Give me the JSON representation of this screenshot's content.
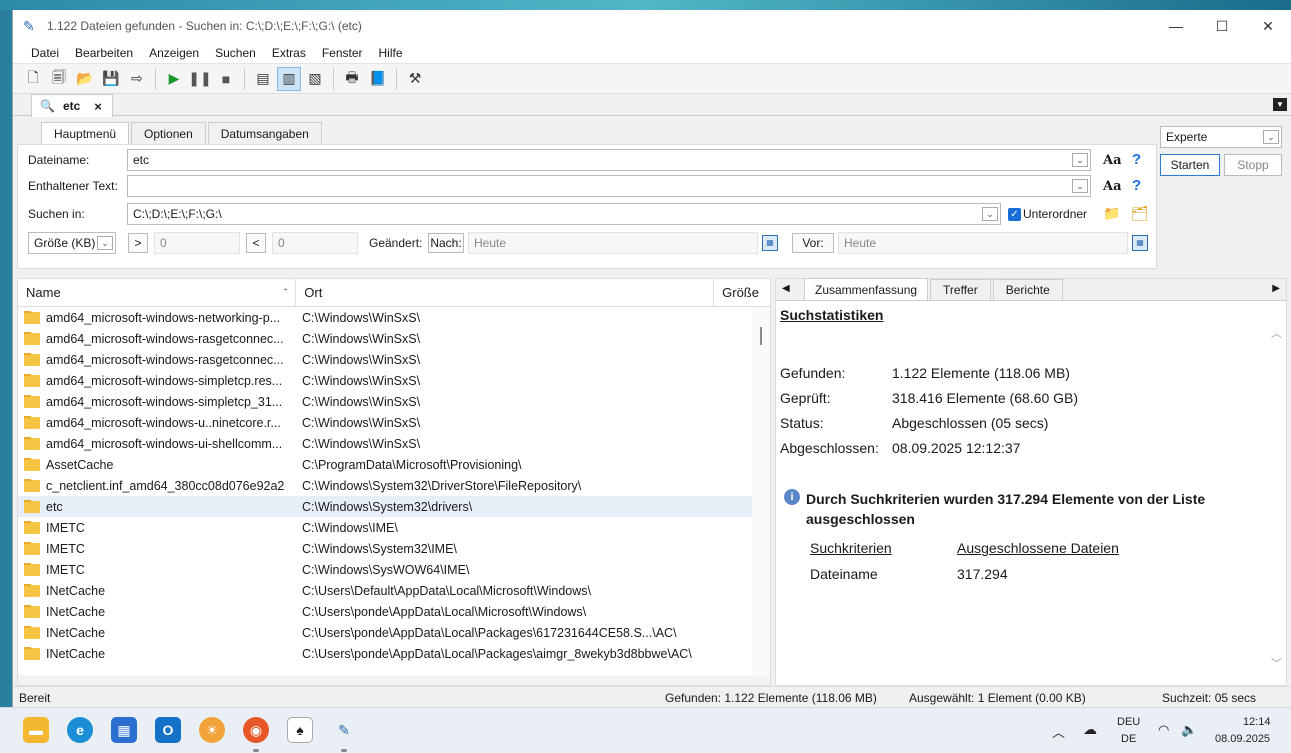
{
  "window": {
    "title": "1.122 Dateien gefunden - Suchen in: C:\\;D:\\;E:\\;F:\\;G:\\ (etc)",
    "minimize": "—",
    "maximize": "☐",
    "close": "✕"
  },
  "menu": [
    "Datei",
    "Bearbeiten",
    "Anzeigen",
    "Suchen",
    "Extras",
    "Fenster",
    "Hilfe"
  ],
  "doctab": {
    "label": "etc",
    "close": "×"
  },
  "subtabs": [
    "Hauptmenü",
    "Optionen",
    "Datumsangaben"
  ],
  "form": {
    "filename_label": "Dateiname:",
    "filename_value": "etc",
    "content_label": "Enthaltener Text:",
    "content_value": "",
    "searchin_label": "Suchen in:",
    "searchin_value": "C:\\;D:\\;E:\\;F:\\;G:\\",
    "subfolders_label": "Unterordner",
    "size_select": "Größe (KB)",
    "gt": ">",
    "gt_value": "0",
    "lt": "<",
    "lt_value": "0",
    "changed_label": "Geändert:",
    "after_btn": "Nach:",
    "after_value": "Heute",
    "before_btn": "Vor:",
    "before_value": "Heute",
    "aa": "Aa",
    "help": "?"
  },
  "mode": {
    "selected": "Experte",
    "start": "Starten",
    "stop": "Stopp"
  },
  "results": {
    "columns": [
      "Name",
      "Ort",
      "Größe"
    ],
    "rows": [
      {
        "name": "amd64_microsoft-windows-networking-p...",
        "path": "C:\\Windows\\WinSxS\\"
      },
      {
        "name": "amd64_microsoft-windows-rasgetconnec...",
        "path": "C:\\Windows\\WinSxS\\"
      },
      {
        "name": "amd64_microsoft-windows-rasgetconnec...",
        "path": "C:\\Windows\\WinSxS\\"
      },
      {
        "name": "amd64_microsoft-windows-simpletcp.res...",
        "path": "C:\\Windows\\WinSxS\\"
      },
      {
        "name": "amd64_microsoft-windows-simpletcp_31...",
        "path": "C:\\Windows\\WinSxS\\"
      },
      {
        "name": "amd64_microsoft-windows-u..ninetcore.r...",
        "path": "C:\\Windows\\WinSxS\\"
      },
      {
        "name": "amd64_microsoft-windows-ui-shellcomm...",
        "path": "C:\\Windows\\WinSxS\\"
      },
      {
        "name": "AssetCache",
        "path": "C:\\ProgramData\\Microsoft\\Provisioning\\"
      },
      {
        "name": "c_netclient.inf_amd64_380cc08d076e92a2",
        "path": "C:\\Windows\\System32\\DriverStore\\FileRepository\\"
      },
      {
        "name": "etc",
        "path": "C:\\Windows\\System32\\drivers\\"
      },
      {
        "name": "IMETC",
        "path": "C:\\Windows\\IME\\"
      },
      {
        "name": "IMETC",
        "path": "C:\\Windows\\System32\\IME\\"
      },
      {
        "name": "IMETC",
        "path": "C:\\Windows\\SysWOW64\\IME\\"
      },
      {
        "name": "INetCache",
        "path": "C:\\Users\\Default\\AppData\\Local\\Microsoft\\Windows\\"
      },
      {
        "name": "INetCache",
        "path": "C:\\Users\\ponde\\AppData\\Local\\Microsoft\\Windows\\"
      },
      {
        "name": "INetCache",
        "path": "C:\\Users\\ponde\\AppData\\Local\\Packages\\617231644CE58.S...\\AC\\"
      },
      {
        "name": "INetCache",
        "path": "C:\\Users\\ponde\\AppData\\Local\\Packages\\aimgr_8wekyb3d8bbwe\\AC\\"
      }
    ]
  },
  "summary": {
    "tabs": [
      "Zusammenfassung",
      "Treffer",
      "Berichte"
    ],
    "heading": "Suchstatistiken",
    "stats": [
      {
        "label": "Gefunden:",
        "value": "1.122 Elemente (118.06 MB)"
      },
      {
        "label": "Geprüft:",
        "value": "318.416 Elemente (68.60 GB)"
      },
      {
        "label": "Status:",
        "value": "Abgeschlossen (05 secs)"
      },
      {
        "label": "Abgeschlossen:",
        "value": "08.09.2025 12:12:37"
      }
    ],
    "message": "Durch Suchkriterien wurden 317.294 Elemente von der Liste ausgeschlossen",
    "crit_header": "Suchkriterien",
    "excl_header": "Ausgeschlossene Dateien",
    "crit_name": "Dateiname",
    "crit_count": "317.294"
  },
  "status": {
    "ready": "Bereit",
    "found": "Gefunden: 1.122 Elemente (118.06 MB)",
    "selected": "Ausgewählt: 1 Element (0.00 KB)",
    "time": "Suchzeit: 05 secs"
  },
  "taskbar": {
    "lang1": "DEU",
    "lang2": "DE",
    "time": "12:14",
    "date": "08.09.2025"
  }
}
